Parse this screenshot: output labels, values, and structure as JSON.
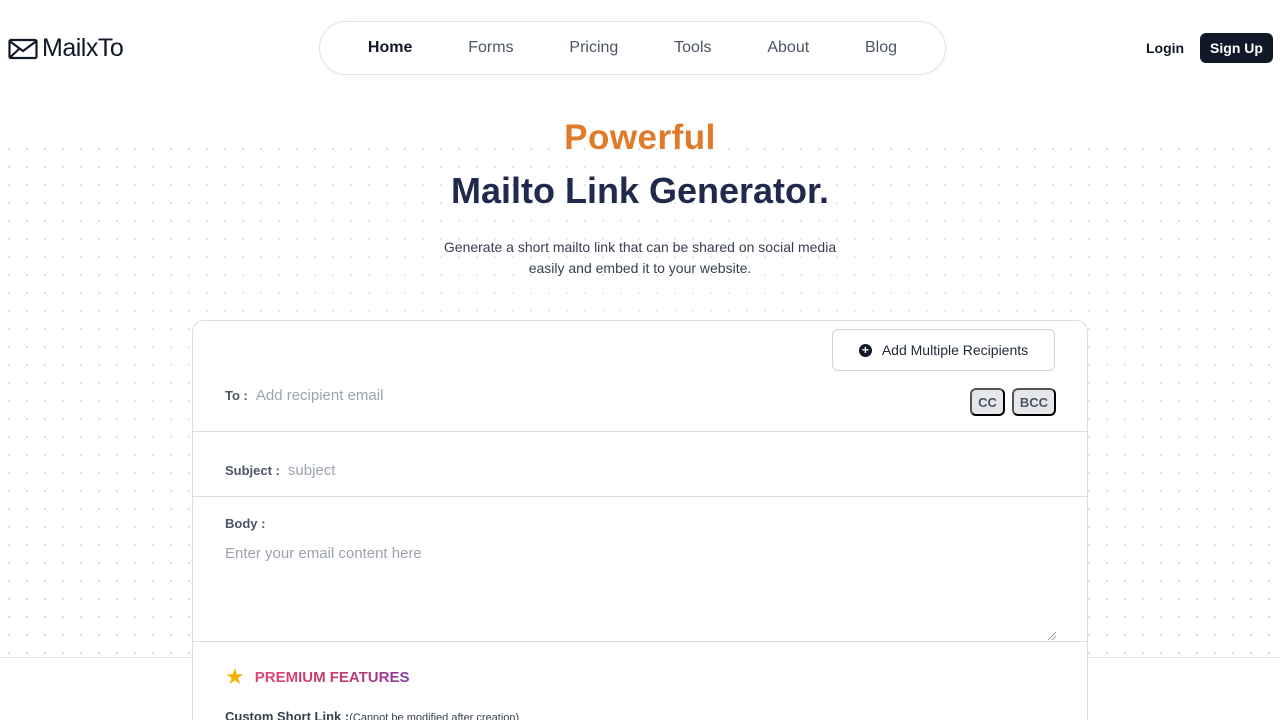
{
  "brand": {
    "name": "MailxTo"
  },
  "nav": {
    "items": [
      {
        "label": "Home",
        "active": true
      },
      {
        "label": "Forms",
        "active": false
      },
      {
        "label": "Pricing",
        "active": false
      },
      {
        "label": "Tools",
        "active": false
      },
      {
        "label": "About",
        "active": false
      },
      {
        "label": "Blog",
        "active": false
      }
    ]
  },
  "auth": {
    "login_label": "Login",
    "signup_label": "Sign Up"
  },
  "hero": {
    "eyebrow": "Powerful",
    "title": "Mailto Link Generator.",
    "subtitle": "Generate a short mailto link that can be shared on social media easily and embed it to your website."
  },
  "form": {
    "add_multiple_label": "Add Multiple Recipients",
    "to_label": "To :",
    "to_placeholder": "Add recipient email",
    "cc_label": "CC",
    "bcc_label": "BCC",
    "subject_label": "Subject :",
    "subject_placeholder": "subject",
    "body_label": "Body :",
    "body_placeholder": "Enter your email content here"
  },
  "premium": {
    "title": "PREMIUM FEATURES",
    "short_link_label": "Custom Short Link :",
    "short_link_note": "(Cannot be modified after creation)"
  },
  "icons": {
    "logo": "envelope-icon",
    "add": "plus-circle-icon",
    "premium": "star-icon"
  },
  "colors": {
    "accent_orange": "#e07b2a",
    "title_navy": "#1f2a4d",
    "button_dark": "#111827",
    "star": "#f5b301"
  }
}
